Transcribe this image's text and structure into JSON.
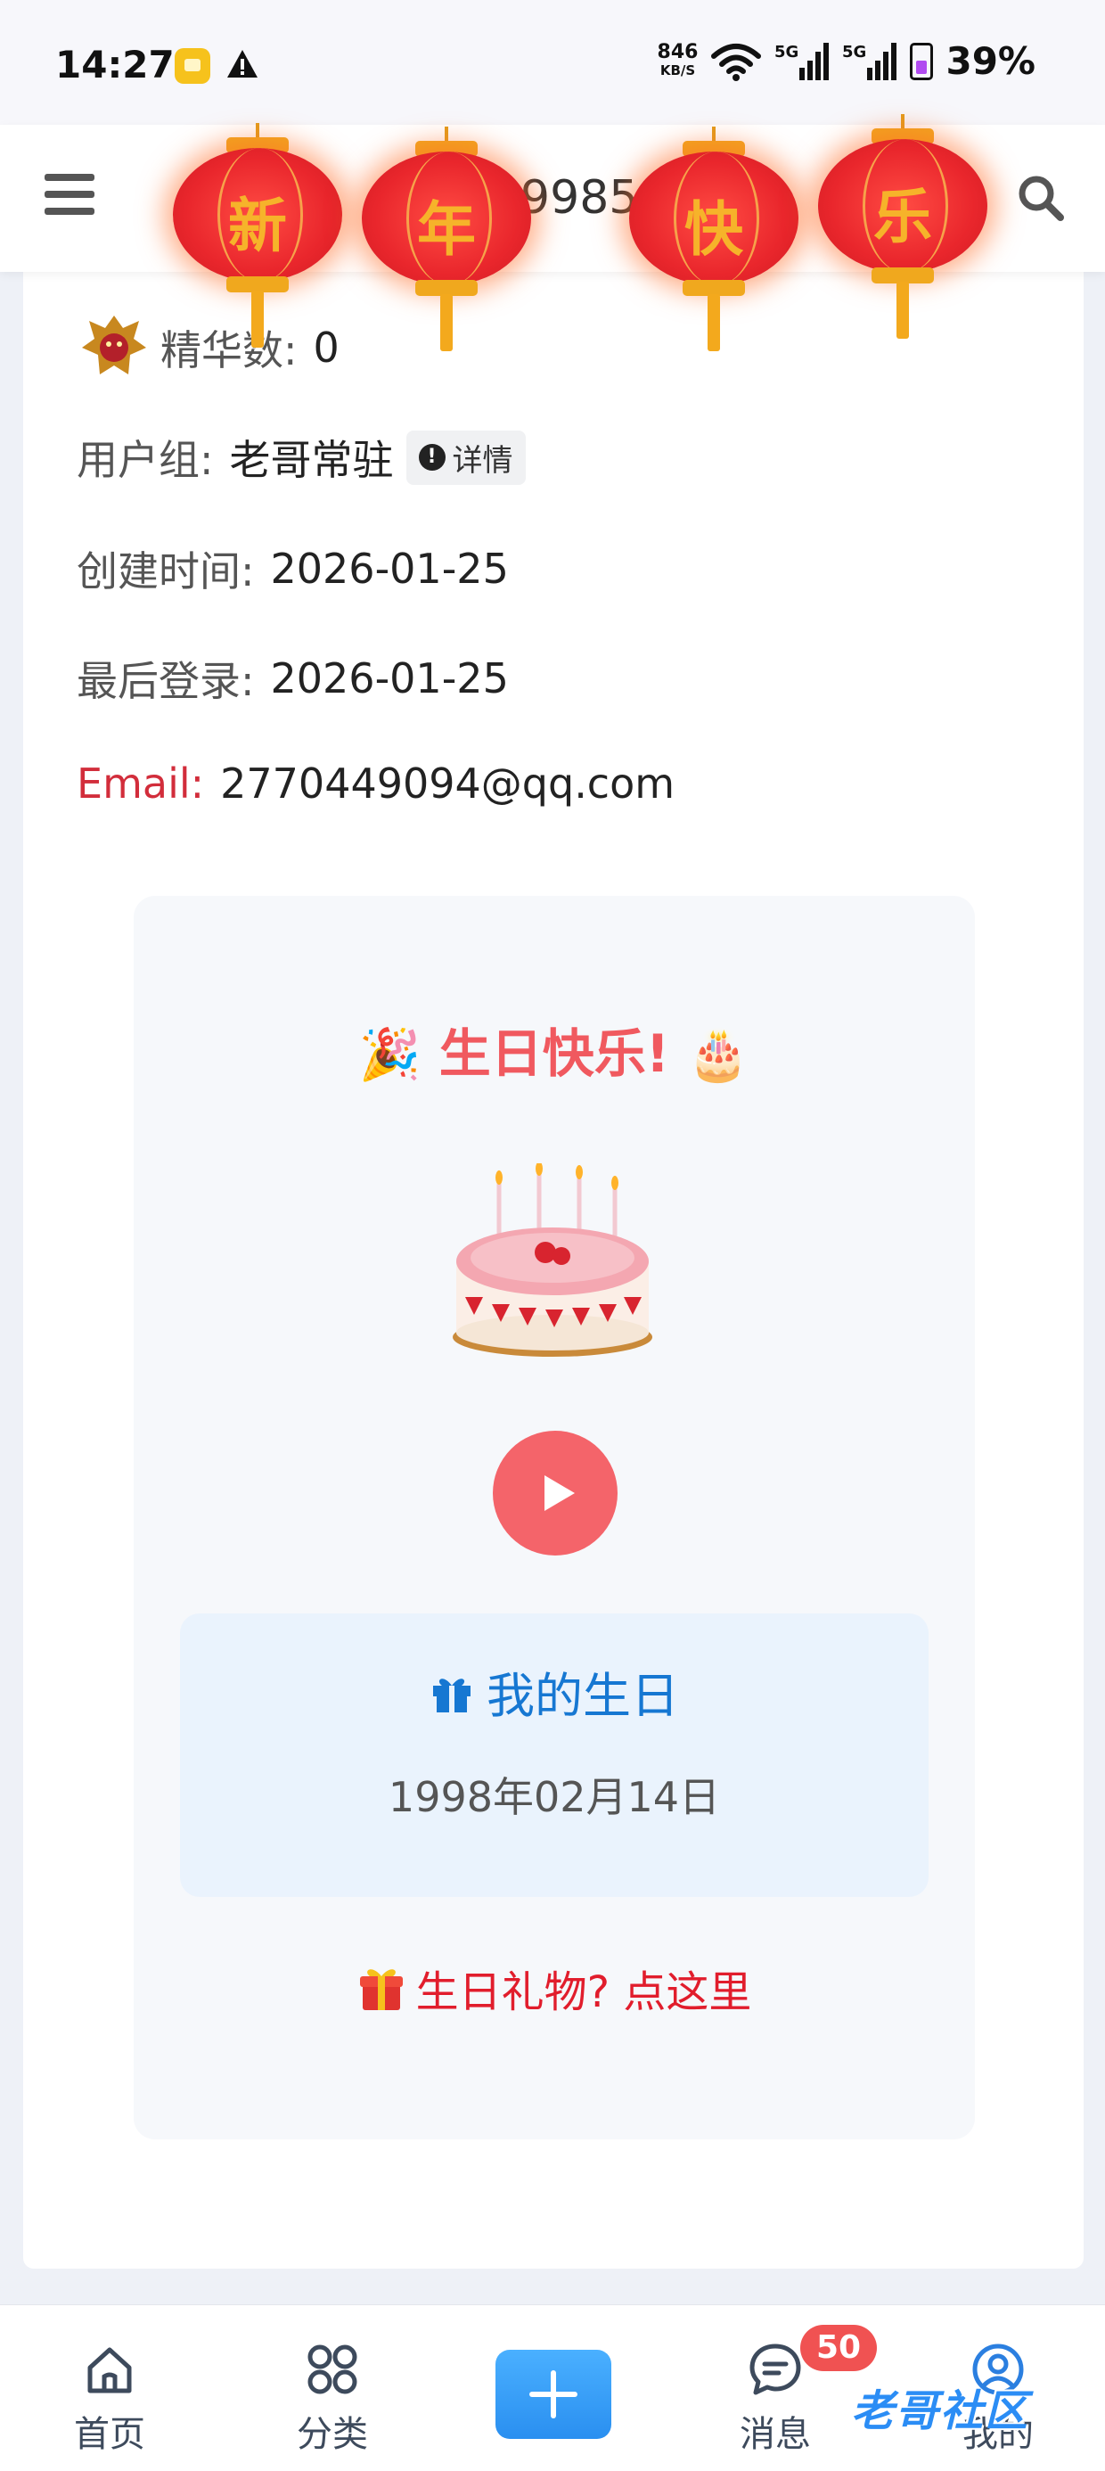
{
  "status_bar": {
    "time": "14:27",
    "net_speed_value": "846",
    "net_speed_unit": "KB/S",
    "signal_1_label": "5G",
    "signal_2_label": "5G",
    "battery_percent": "39%",
    "battery_color": "#b14bf0"
  },
  "header": {
    "title": "ca199851",
    "menu_icon": "hamburger-menu-icon",
    "search_icon": "search-icon"
  },
  "lanterns": [
    "新",
    "年",
    "快",
    "乐"
  ],
  "profile": {
    "essence_label": "精华数:",
    "essence_value": "0",
    "group_label": "用户组:",
    "group_value": "老哥常驻",
    "group_detail_label": "详情",
    "created_label": "创建时间:",
    "created_value": "2026-01-25",
    "last_login_label": "最后登录:",
    "last_login_value": "2026-01-25",
    "email_label": "Email:",
    "email_value": "2770449094@qq.com"
  },
  "birthday": {
    "greeting": "生日快乐!",
    "greeting_left_emoji": "🎉",
    "greeting_right_emoji": "🎂",
    "my_birthday_label": "我的生日",
    "my_birthday_date": "1998年02月14日",
    "gift_link_label": "生日礼物? 点这里",
    "accent_color": "#f0595f"
  },
  "bottom_nav": {
    "home_label": "首页",
    "category_label": "分类",
    "messages_label": "消息",
    "messages_badge": "50",
    "me_label": "我的",
    "watermark": "老哥社区"
  }
}
